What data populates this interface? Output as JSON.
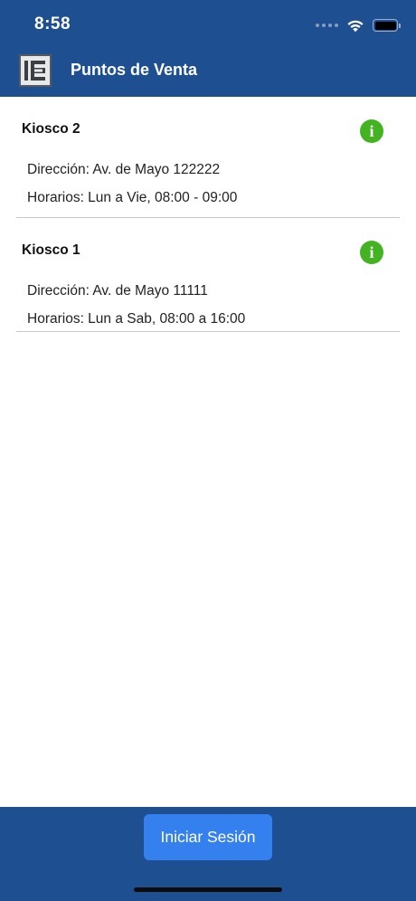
{
  "status_bar": {
    "time": "8:58",
    "icons": [
      "signal-icon",
      "wifi-icon",
      "battery-icon"
    ]
  },
  "nav": {
    "logo_icon": "app-logo-icon",
    "title": "Puntos de Venta"
  },
  "kiosks": [
    {
      "name": "Kiosco 2",
      "address": "Dirección: Av. de Mayo 122222",
      "hours": "Horarios: Lun a Vie, 08:00 - 09:00",
      "info_icon": "info-icon"
    },
    {
      "name": "Kiosco 1",
      "address": "Dirección: Av. de Mayo 11111",
      "hours": "Horarios: Lun a Sab, 08:00 a 16:00",
      "info_icon": "info-icon"
    }
  ],
  "footer": {
    "login_label": "Iniciar Sesión"
  },
  "colors": {
    "bar_blue": "#1e4f91",
    "button_blue": "#3580ef",
    "info_green": "#43b321"
  }
}
